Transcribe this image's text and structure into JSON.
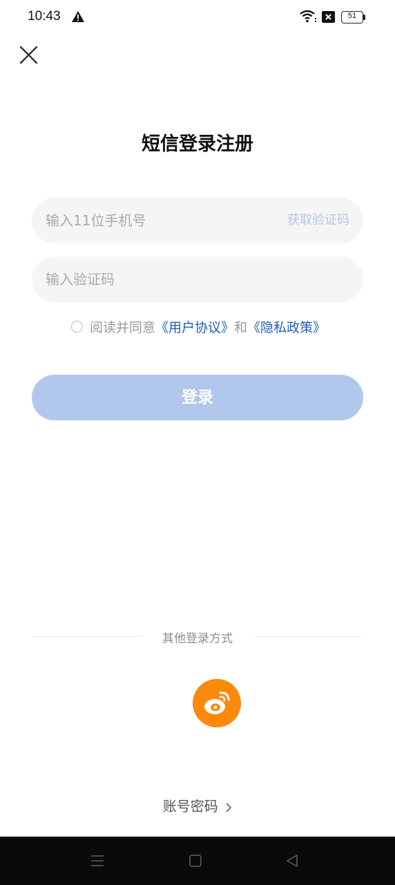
{
  "status_bar": {
    "time": "10:43",
    "battery_level": "51",
    "icons": [
      "alert-icon",
      "wifi-icon",
      "x-box-icon",
      "battery-icon"
    ]
  },
  "close_icon": "close-icon",
  "title": "短信登录注册",
  "phone_field": {
    "placeholder": "输入11位手机号",
    "get_code_label": "获取验证码"
  },
  "code_field": {
    "placeholder": "输入验证码"
  },
  "agreement": {
    "prefix": "阅读并同意",
    "user_agreement": "《用户协议》",
    "connector": "和",
    "privacy_policy": "《隐私政策》",
    "checked": false
  },
  "login_button_label": "登录",
  "other_login": {
    "label": "其他登录方式",
    "methods": [
      "weibo-icon"
    ]
  },
  "account_login_label": "账号密码",
  "colors": {
    "accent_link": "#1f5fb5",
    "login_button_disabled": "#b2c7ec",
    "get_code_disabled": "#b7c6e6",
    "weibo": "#fb8a0c"
  },
  "nav_bar": {
    "icons": [
      "menu-icon",
      "home-icon",
      "back-icon"
    ]
  }
}
